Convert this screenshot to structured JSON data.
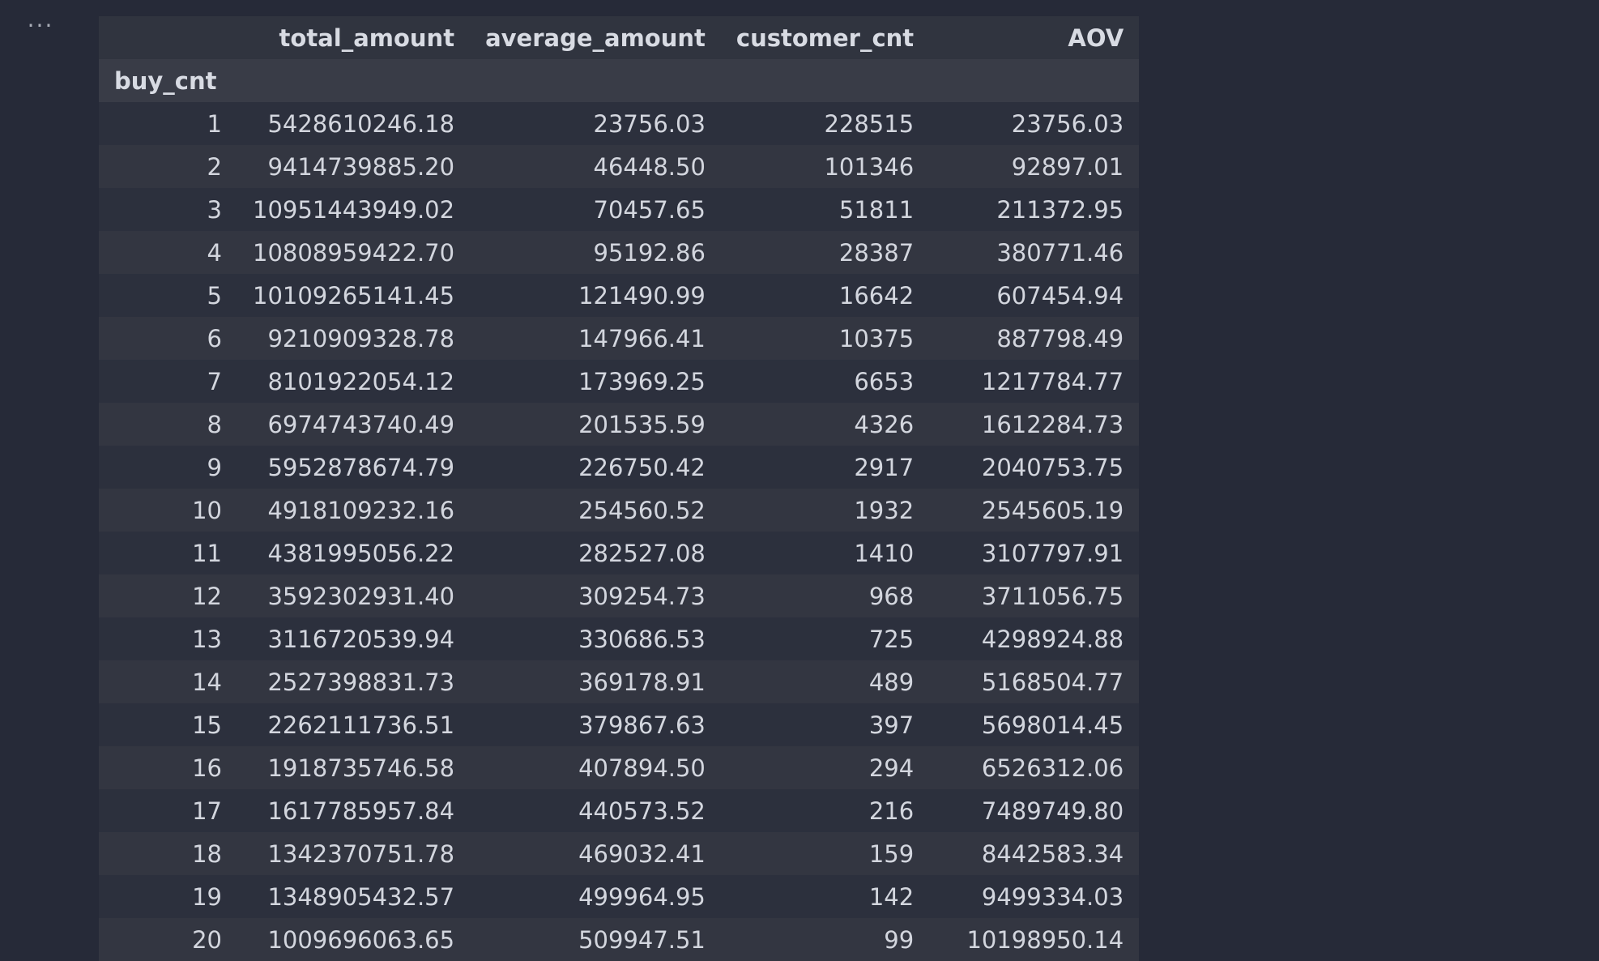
{
  "cell_menu": {
    "icon": "more-horizontal-icon",
    "glyph": "···"
  },
  "table": {
    "index_name": "buy_cnt",
    "index_header": "",
    "columns": [
      "total_amount",
      "average_amount",
      "customer_cnt",
      "AOV"
    ],
    "rows": [
      [
        "1",
        "5428610246.18",
        "23756.03",
        "228515",
        "23756.03"
      ],
      [
        "2",
        "9414739885.20",
        "46448.50",
        "101346",
        "92897.01"
      ],
      [
        "3",
        "10951443949.02",
        "70457.65",
        "51811",
        "211372.95"
      ],
      [
        "4",
        "10808959422.70",
        "95192.86",
        "28387",
        "380771.46"
      ],
      [
        "5",
        "10109265141.45",
        "121490.99",
        "16642",
        "607454.94"
      ],
      [
        "6",
        "9210909328.78",
        "147966.41",
        "10375",
        "887798.49"
      ],
      [
        "7",
        "8101922054.12",
        "173969.25",
        "6653",
        "1217784.77"
      ],
      [
        "8",
        "6974743740.49",
        "201535.59",
        "4326",
        "1612284.73"
      ],
      [
        "9",
        "5952878674.79",
        "226750.42",
        "2917",
        "2040753.75"
      ],
      [
        "10",
        "4918109232.16",
        "254560.52",
        "1932",
        "2545605.19"
      ],
      [
        "11",
        "4381995056.22",
        "282527.08",
        "1410",
        "3107797.91"
      ],
      [
        "12",
        "3592302931.40",
        "309254.73",
        "968",
        "3711056.75"
      ],
      [
        "13",
        "3116720539.94",
        "330686.53",
        "725",
        "4298924.88"
      ],
      [
        "14",
        "2527398831.73",
        "369178.91",
        "489",
        "5168504.77"
      ],
      [
        "15",
        "2262111736.51",
        "379867.63",
        "397",
        "5698014.45"
      ],
      [
        "16",
        "1918735746.58",
        "407894.50",
        "294",
        "6526312.06"
      ],
      [
        "17",
        "1617785957.84",
        "440573.52",
        "216",
        "7489749.80"
      ],
      [
        "18",
        "1342370751.78",
        "469032.41",
        "159",
        "8442583.34"
      ],
      [
        "19",
        "1348905432.57",
        "499964.95",
        "142",
        "9499334.03"
      ],
      [
        "20",
        "1009696063.65",
        "509947.51",
        "99",
        "10198950.14"
      ]
    ]
  }
}
